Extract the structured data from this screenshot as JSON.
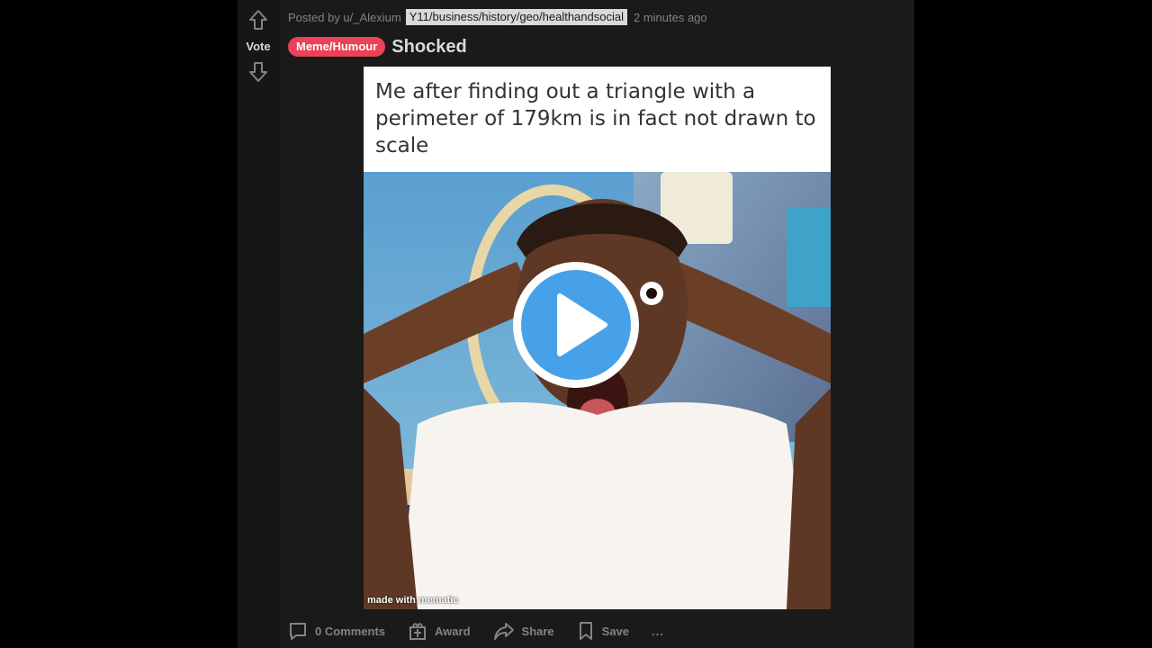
{
  "post": {
    "vote_label": "Vote",
    "posted_by": "Posted by u/_Alexium",
    "subreddit_path": "Y11/business/history/geo/healthandsocial",
    "time": "2 minutes ago",
    "flair": "Meme/Humour",
    "title": "Shocked"
  },
  "media": {
    "caption": "Me after finding out a triangle with a perimeter of 179km is in fact not drawn to scale",
    "watermark": "made with mematic"
  },
  "actions": {
    "comments": "0 Comments",
    "award": "Award",
    "share": "Share",
    "save": "Save",
    "more": "..."
  },
  "colors": {
    "background": "#000000",
    "card": "#1a1a1b",
    "flair": "#ea4256",
    "play": "#47a1e8",
    "muted_text": "#818384",
    "text": "#d7dadc"
  },
  "icons": {
    "upvote": "arrow-up-icon",
    "downvote": "arrow-down-icon",
    "comments": "comment-icon",
    "award": "award-icon",
    "share": "share-icon",
    "save": "bookmark-icon",
    "play": "play-icon"
  }
}
